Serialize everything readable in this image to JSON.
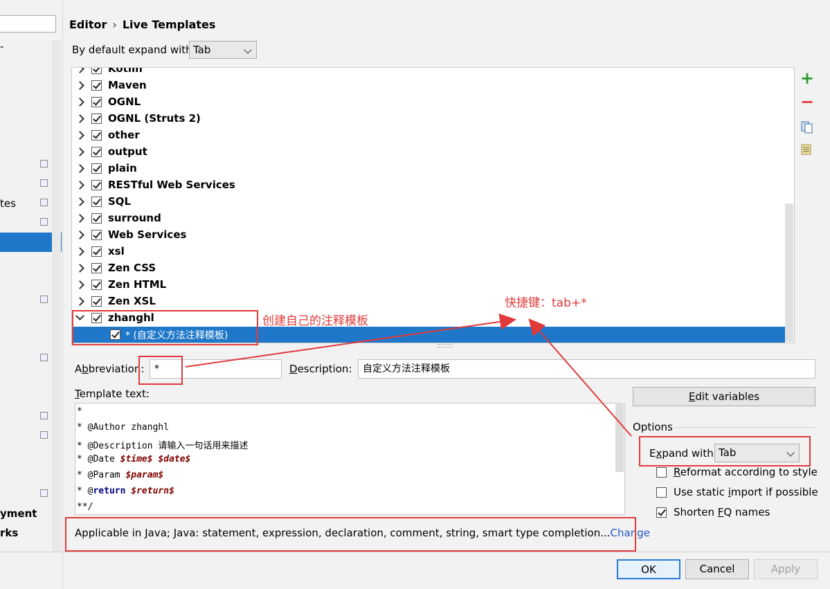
{
  "left_panel": {
    "items": [
      {
        "text": "-"
      },
      {
        "text": "tes"
      },
      {
        "text": "yment"
      },
      {
        "text": "rks"
      }
    ]
  },
  "breadcrumb": {
    "editor": "Editor",
    "sep": "›",
    "current": "Live Templates"
  },
  "default_expand": {
    "label": "By default expand with",
    "value": "Tab"
  },
  "tree": {
    "groups": [
      "Kotlin",
      "Maven",
      "OGNL",
      "OGNL (Struts 2)",
      "other",
      "output",
      "plain",
      "RESTful Web Services",
      "SQL",
      "surround",
      "Web Services",
      "xsl",
      "Zen CSS",
      "Zen HTML",
      "Zen XSL",
      "zhanghl"
    ],
    "selected_child": "* (自定义方法注释模板)"
  },
  "toolbar": {
    "add": "+",
    "remove": "−"
  },
  "abbreviation": {
    "label_pre": "A",
    "label_u": "b",
    "label_post": "breviation:",
    "value": "*"
  },
  "description": {
    "label_u": "D",
    "label_post": "escription:",
    "value": "自定义方法注释模板"
  },
  "template_text": {
    "label_u": "T",
    "label_post": "emplate text:",
    "lines": [
      {
        "plain": "*"
      },
      {
        "plain": "* @Author zhanghl"
      },
      {
        "plain": "* @Description 请输入一句话用来描述"
      },
      {
        "pre": "* @Date ",
        "var1": "$time$",
        "mid": " ",
        "var2": "$date$"
      },
      {
        "pre": "* @Param ",
        "var1": "$param$"
      },
      {
        "pre": "* @",
        "kw": "return",
        "mid": " ",
        "var1": "$return$"
      },
      {
        "plain": "**/"
      }
    ]
  },
  "applicable": {
    "text": "Applicable in Java; Java: statement, expression, declaration, comment, string, smart type completion...",
    "link": "Change"
  },
  "edit_variables": {
    "u": "E",
    "rest": "dit variables"
  },
  "options": {
    "title": "Options",
    "expand_with": {
      "pre": "E",
      "u": "x",
      "post": "pand with",
      "value": "Tab"
    },
    "reformat": {
      "u": "R",
      "rest": "eformat according to style",
      "checked": false
    },
    "static_import": {
      "pre": "Use static ",
      "u": "i",
      "post": "mport if possible",
      "checked": false
    },
    "shorten": {
      "pre": "Shorten ",
      "u": "F",
      "post": "Q names",
      "checked": true
    }
  },
  "buttons": {
    "ok": "OK",
    "cancel": "Cancel",
    "apply": "Apply"
  },
  "annotations": {
    "create": "创建自己的注释模板",
    "shortcut": "快捷键：tab+*"
  },
  "colors": {
    "selection": "#1f77c9",
    "annotation_red": "#e03a3a",
    "link": "#2255cc",
    "add_green": "#2a9a2a"
  }
}
